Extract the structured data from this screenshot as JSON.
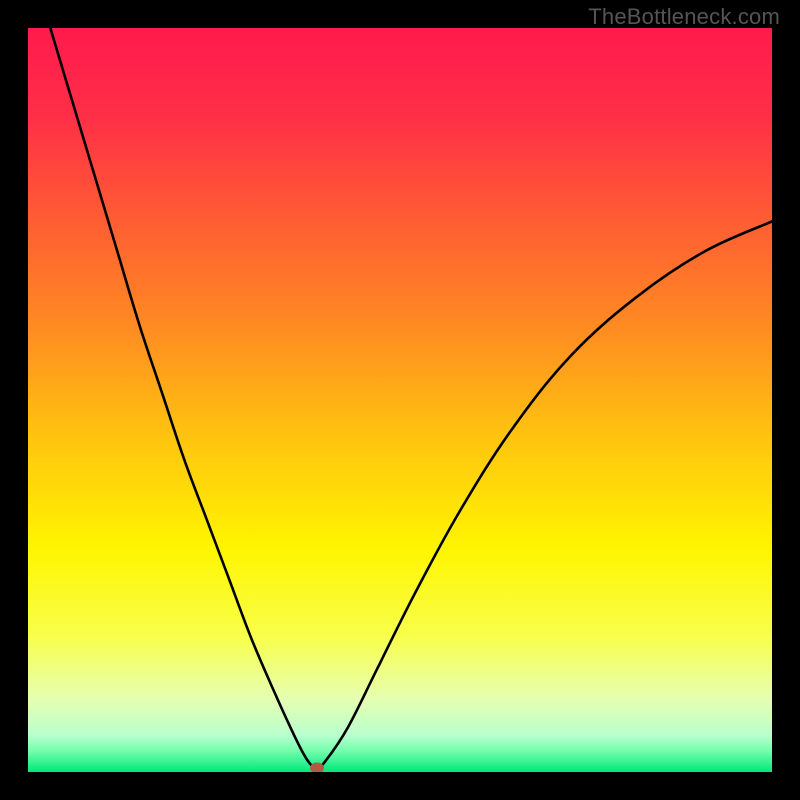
{
  "watermark": "TheBottleneck.com",
  "chart_data": {
    "type": "line",
    "title": "",
    "xlabel": "",
    "ylabel": "",
    "xlim": [
      0,
      100
    ],
    "ylim": [
      0,
      100
    ],
    "gradient_stops": [
      {
        "offset": 0,
        "color": "#ff1a4d"
      },
      {
        "offset": 12,
        "color": "#ff2f47"
      },
      {
        "offset": 25,
        "color": "#ff5a34"
      },
      {
        "offset": 40,
        "color": "#ff8a22"
      },
      {
        "offset": 55,
        "color": "#ffc40f"
      },
      {
        "offset": 70,
        "color": "#fff500"
      },
      {
        "offset": 82,
        "color": "#f8ff4d"
      },
      {
        "offset": 90,
        "color": "#e6ffb0"
      },
      {
        "offset": 95,
        "color": "#baffce"
      },
      {
        "offset": 97,
        "color": "#7affb0"
      },
      {
        "offset": 100,
        "color": "#00e87a"
      }
    ],
    "series": [
      {
        "name": "bottleneck-curve",
        "x": [
          3,
          6,
          9,
          12,
          15,
          18,
          21,
          24,
          27,
          30,
          33,
          35.5,
          37,
          38,
          38.8,
          40,
          43,
          47,
          52,
          58,
          65,
          73,
          82,
          91,
          100
        ],
        "y": [
          100,
          90,
          80,
          70,
          60,
          51,
          42,
          34,
          26,
          18,
          11,
          5.5,
          2.5,
          1.0,
          0.5,
          1.5,
          6,
          14,
          24,
          35,
          46,
          56,
          64,
          70,
          74
        ]
      }
    ],
    "minimum_point": {
      "x": 38.8,
      "y": 0.5,
      "color": "#b25a46"
    }
  }
}
